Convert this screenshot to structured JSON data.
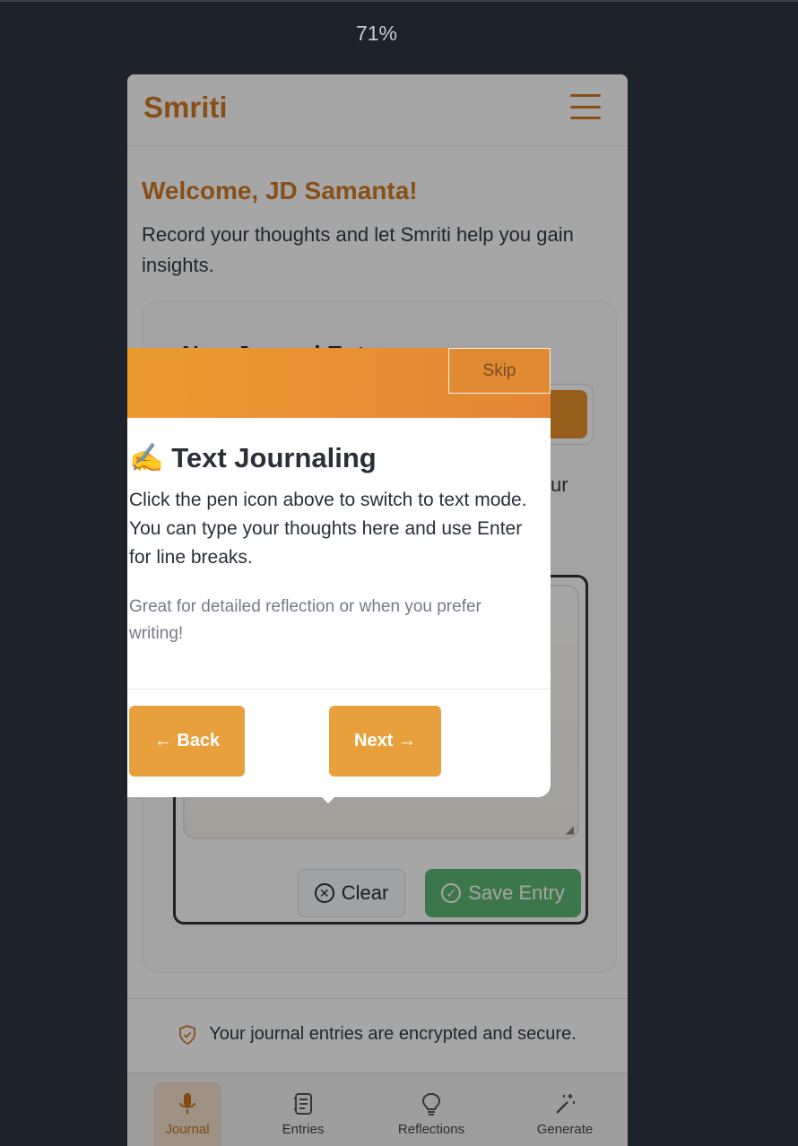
{
  "zoom": "71%",
  "app": {
    "brand": "Smriti"
  },
  "welcome": {
    "title": "Welcome, JD Samanta!",
    "subtitle": "Record your thoughts and let Smriti help you gain insights."
  },
  "journal_card": {
    "title_partial": "New Journal Entry",
    "hint_tail": "ur",
    "clear_label": "Clear",
    "save_label": "Save Entry"
  },
  "secure_note": "Your journal entries are encrypted and secure.",
  "bottom_nav": [
    {
      "label": "Journal",
      "icon": "microphone-icon",
      "active": true
    },
    {
      "label": "Entries",
      "icon": "notebook-icon",
      "active": false
    },
    {
      "label": "Reflections",
      "icon": "lightbulb-icon",
      "active": false
    },
    {
      "label": "Generate",
      "icon": "magic-wand-icon",
      "active": false
    }
  ],
  "tour": {
    "skip_label": "Skip",
    "title": "✍️ Text Journaling",
    "body": "Click the pen icon above to switch to text mode. You can type your thoughts here and use Enter for line breaks.",
    "note": "Great for detailed reflection or when you prefer writing!",
    "back_label": "← Back",
    "next_label": "Next →"
  },
  "colors": {
    "brand": "#d17b26",
    "accent_button": "#e8a03d",
    "save_green": "#5cb774",
    "background": "#1e222b"
  }
}
